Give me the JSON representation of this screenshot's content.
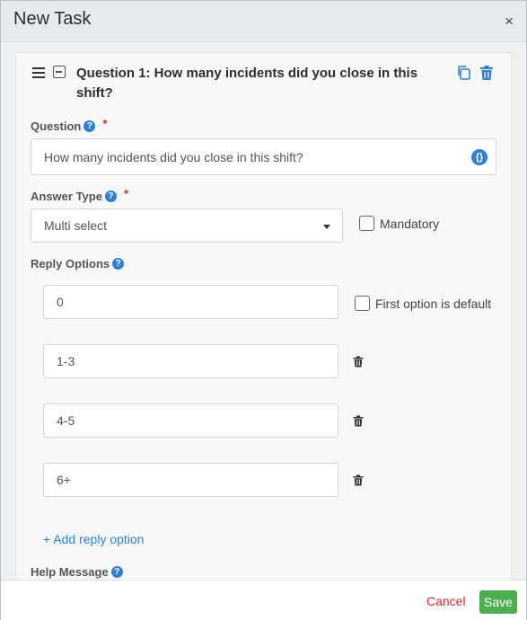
{
  "dialog": {
    "title": "New Task",
    "close_label": "×"
  },
  "question_card": {
    "heading": "Question 1: How many incidents did you close in this shift?",
    "question_label": "Question",
    "question_value": "How many incidents did you close in this shift?",
    "variable_icon_glyph": "{}",
    "answer_type_label": "Answer Type",
    "answer_type_value": "Multi select",
    "mandatory_label": "Mandatory",
    "reply_options_label": "Reply Options",
    "reply_options": [
      {
        "value": "0"
      },
      {
        "value": "1-3"
      },
      {
        "value": "4-5"
      },
      {
        "value": "6+"
      }
    ],
    "first_option_default_label": "First option is default",
    "add_reply_option_label": "+ Add reply option",
    "help_message_label": "Help Message",
    "required_marker": "*",
    "help_glyph": "?"
  },
  "footer": {
    "cancel_label": "Cancel",
    "save_label": "Save"
  },
  "colors": {
    "accent": "#2f80d1",
    "danger": "#d9292b",
    "success": "#4cae4f",
    "header_bg": "#e6eaed"
  },
  "icons": [
    "close-icon",
    "drag-handle-icon",
    "collapse-icon",
    "copy-icon",
    "trash-icon",
    "help-icon",
    "variable-icon",
    "chevron-down-icon"
  ]
}
